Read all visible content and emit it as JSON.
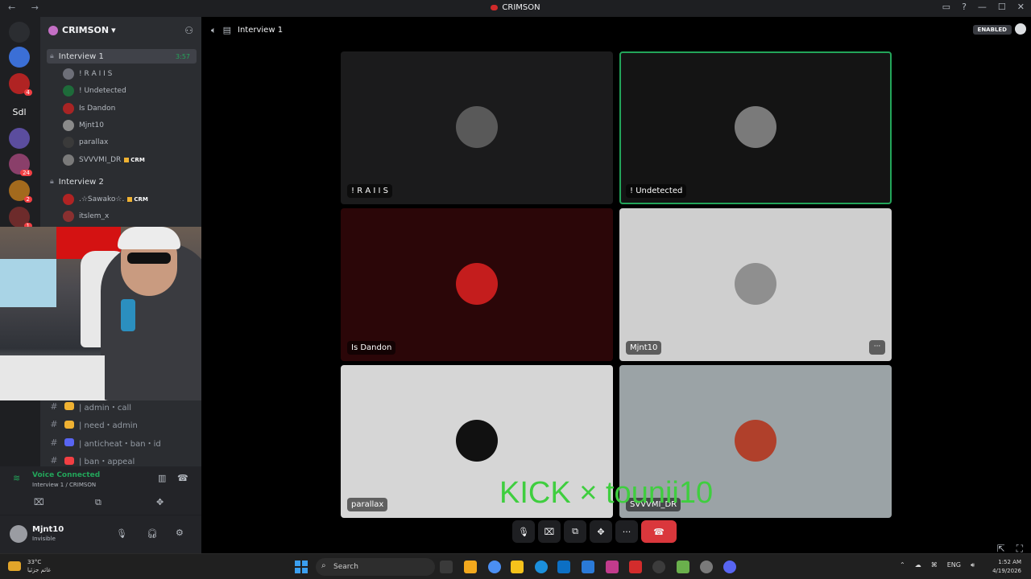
{
  "window": {
    "title": "CRIMSON",
    "nav_arrows": "← →",
    "controls": [
      "▭",
      "?",
      "—",
      "☐",
      "✕"
    ]
  },
  "servers": [
    {
      "label": "",
      "badge": "",
      "color": "#2b2d31"
    },
    {
      "label": "",
      "badge": "",
      "color": "#3b6fd6"
    },
    {
      "label": "",
      "badge": "4",
      "color": "#b02323"
    },
    {
      "label": "Sdl",
      "badge": "",
      "color": "#1e1f22"
    },
    {
      "label": "",
      "badge": "",
      "color": "#5b4d9e"
    },
    {
      "label": "",
      "badge": "24",
      "color": "#8a3f6a"
    },
    {
      "label": "",
      "badge": "2",
      "color": "#a36a1d"
    },
    {
      "label": "",
      "badge": "1",
      "color": "#6d2b2b"
    }
  ],
  "sidebar": {
    "guild_name": "CRIMSON",
    "guild_chevron": "▾",
    "channel1": {
      "name": "Interview 1",
      "time": "3:57"
    },
    "channel1_users": [
      {
        "name": "! R A I I S",
        "tag": ""
      },
      {
        "name": "! Undetected",
        "tag": ""
      },
      {
        "name": "Is Dandon",
        "tag": ""
      },
      {
        "name": "Mjnt10",
        "tag": ""
      },
      {
        "name": "parallax",
        "tag": ""
      },
      {
        "name": "SVVVMI_DR",
        "tag": "CRM"
      }
    ],
    "channel2": {
      "name": "Interview 2"
    },
    "channel2_users": [
      {
        "name": ".☆Sawako☆.",
        "tag": "CRM"
      },
      {
        "name": "itslem_x",
        "tag": ""
      }
    ],
    "text_channels": [
      {
        "name": "| admin・call",
        "color": "#f0b232"
      },
      {
        "name": "| need・admin",
        "color": "#f0b232"
      },
      {
        "name": "| anticheat・ban・id",
        "color": "#5865f2"
      },
      {
        "name": "| ban・appeal",
        "color": "#f23f43"
      }
    ]
  },
  "voice_panel": {
    "status": "Voice Connected",
    "location": "Interview 1 / CRIMSON"
  },
  "user_panel": {
    "name": "Mjnt10",
    "status": "Invisible"
  },
  "main": {
    "breadcrumb": "Interview 1",
    "enabled_badge": "ENABLED",
    "tiles": [
      {
        "name": "! R A I I S",
        "bg": "#1b1b1c",
        "avatar": "#595959",
        "speaking": false,
        "more": false
      },
      {
        "name": "! Undetected",
        "bg": "#141414",
        "avatar": "#7a7a7a",
        "speaking": true,
        "more": false
      },
      {
        "name": "Is Dandon",
        "bg": "#2b0608",
        "avatar": "#c41d1d",
        "speaking": false,
        "more": false
      },
      {
        "name": "Mjnt10",
        "bg": "#cfcfcf",
        "avatar": "#8f8f8f",
        "speaking": false,
        "more": true
      },
      {
        "name": "parallax",
        "bg": "#d6d6d6",
        "avatar": "#111111",
        "speaking": false,
        "more": false
      },
      {
        "name": "SVVVMI_DR",
        "bg": "#9ba3a6",
        "avatar": "#b0402b",
        "speaking": false,
        "more": false
      }
    ],
    "overlay_text": "KICK × tounii10",
    "more_label": "···"
  },
  "call_controls": {
    "mic": "🎙",
    "camera": "⌧",
    "share": "⧉",
    "activities": "✥",
    "more": "···",
    "hangup": "☎"
  },
  "taskbar": {
    "weather_temp": "33°C",
    "weather_desc": "غائم جزئيا",
    "search_placeholder": "Search",
    "lang": "ENG",
    "time": "1:52 AM",
    "date": "4/19/2026"
  }
}
